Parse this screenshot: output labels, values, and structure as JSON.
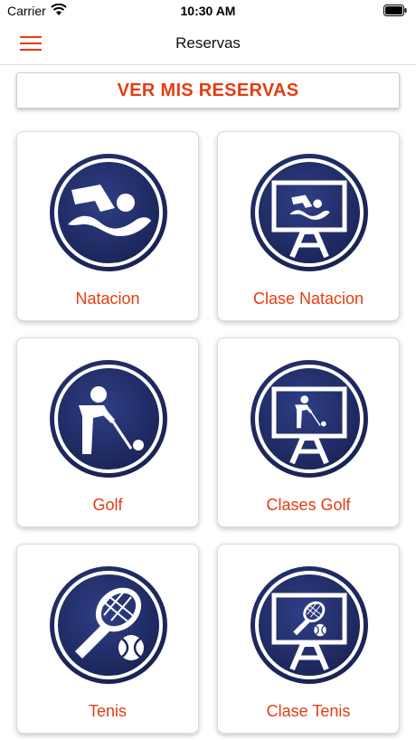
{
  "status_bar": {
    "carrier": "Carrier",
    "time": "10:30 AM"
  },
  "nav": {
    "title": "Reservas",
    "menu_icon": "hamburger-menu-icon"
  },
  "my_bookings": {
    "label": "VER MIS RESERVAS"
  },
  "colors": {
    "accent": "#e63c12",
    "emblem_dark": "#1b2559",
    "emblem_light": "#2f3f86"
  },
  "cards": [
    {
      "label": "Natacion",
      "icon": "swimming-icon"
    },
    {
      "label": "Clase Natacion",
      "icon": "swimming-class-icon"
    },
    {
      "label": "Golf",
      "icon": "golf-icon"
    },
    {
      "label": "Clases Golf",
      "icon": "golf-class-icon"
    },
    {
      "label": "Tenis",
      "icon": "tennis-icon"
    },
    {
      "label": "Clase Tenis",
      "icon": "tennis-class-icon"
    }
  ]
}
